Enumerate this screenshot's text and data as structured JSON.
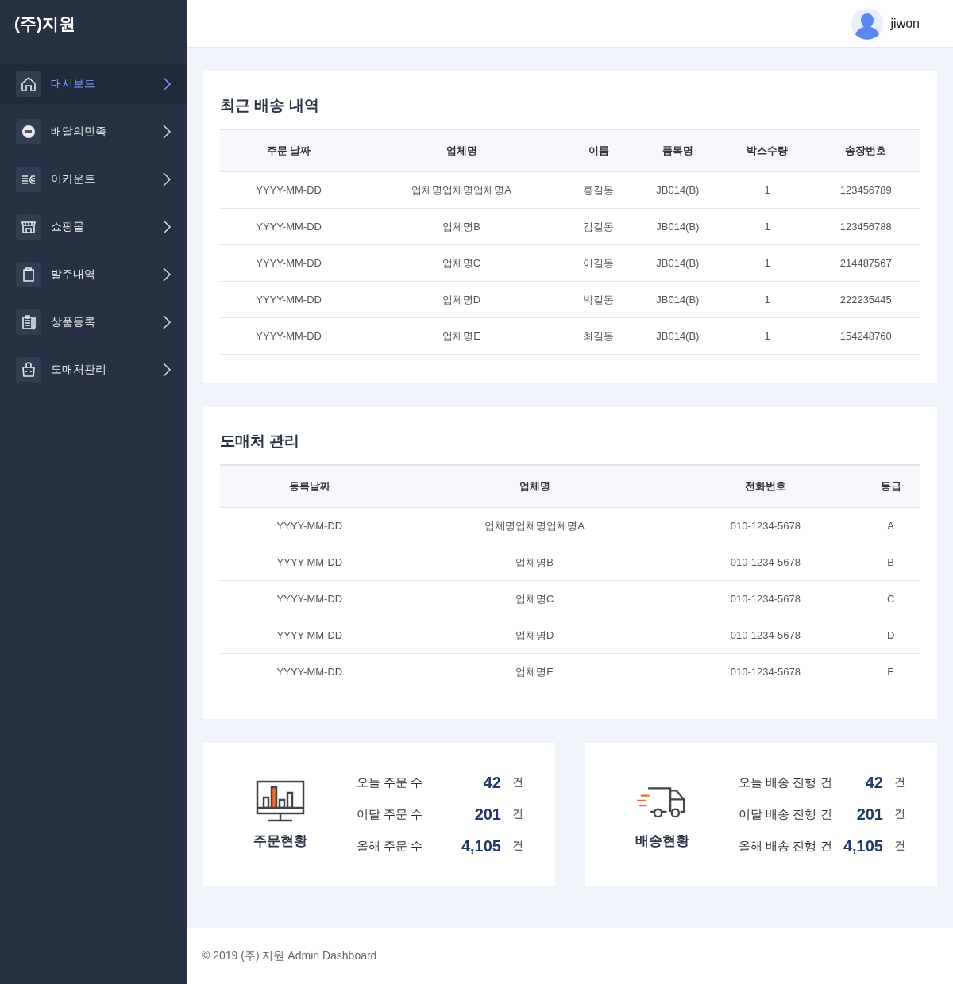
{
  "sidebar": {
    "brand": "(주)지원",
    "items": [
      {
        "label": "대시보드",
        "selected": true
      },
      {
        "label": "배달의민족",
        "selected": false
      },
      {
        "label": "이카운트",
        "selected": false
      },
      {
        "label": "쇼핑몰",
        "selected": false
      },
      {
        "label": "발주내역",
        "selected": false
      },
      {
        "label": "상품등록",
        "selected": false
      },
      {
        "label": "도매처관리",
        "selected": false
      }
    ]
  },
  "header": {
    "user": "jiwon"
  },
  "recent_shipments": {
    "title": "최근 배송 내역",
    "columns": [
      "주문 날짜",
      "업체명",
      "이름",
      "품목명",
      "박스수량",
      "송장번호"
    ],
    "rows": [
      [
        "YYYY-MM-DD",
        "업체명업체명업체명A",
        "홍길동",
        "JB014(B)",
        "1",
        "123456789"
      ],
      [
        "YYYY-MM-DD",
        "업체명B",
        "김길동",
        "JB014(B)",
        "1",
        "123456788"
      ],
      [
        "YYYY-MM-DD",
        "업체명C",
        "이길동",
        "JB014(B)",
        "1",
        "214487567"
      ],
      [
        "YYYY-MM-DD",
        "업체명D",
        "박길동",
        "JB014(B)",
        "1",
        "222235445"
      ],
      [
        "YYYY-MM-DD",
        "업체명E",
        "최길동",
        "JB014(B)",
        "1",
        "154248760"
      ]
    ]
  },
  "wholesalers": {
    "title": "도매처 관리",
    "columns": [
      "등록날짜",
      "업체명",
      "전화번호",
      "등급"
    ],
    "rows": [
      [
        "YYYY-MM-DD",
        "업체명업체명업체명A",
        "010-1234-5678",
        "A"
      ],
      [
        "YYYY-MM-DD",
        "업체명B",
        "010-1234-5678",
        "B"
      ],
      [
        "YYYY-MM-DD",
        "업체명C",
        "010-1234-5678",
        "C"
      ],
      [
        "YYYY-MM-DD",
        "업체명D",
        "010-1234-5678",
        "D"
      ],
      [
        "YYYY-MM-DD",
        "업체명E",
        "010-1234-5678",
        "E"
      ]
    ]
  },
  "stats": [
    {
      "kind": "orders",
      "title": "주문현황",
      "rows": [
        {
          "label": "오늘 주문 수",
          "value": "42",
          "unit": "건"
        },
        {
          "label": "이달 주문 수",
          "value": "201",
          "unit": "건"
        },
        {
          "label": "올해 주문 수",
          "value": "4,105",
          "unit": "건"
        }
      ]
    },
    {
      "kind": "delivery",
      "title": "배송현황",
      "rows": [
        {
          "label": "오늘 배송 진행 건",
          "value": "42",
          "unit": "건"
        },
        {
          "label": "이달 배송 진행 건",
          "value": "201",
          "unit": "건"
        },
        {
          "label": "올해 배송 진행 건",
          "value": "4,105",
          "unit": "건"
        }
      ]
    }
  ],
  "footer": "© 2019 (주) 지원 Admin Dashboard"
}
